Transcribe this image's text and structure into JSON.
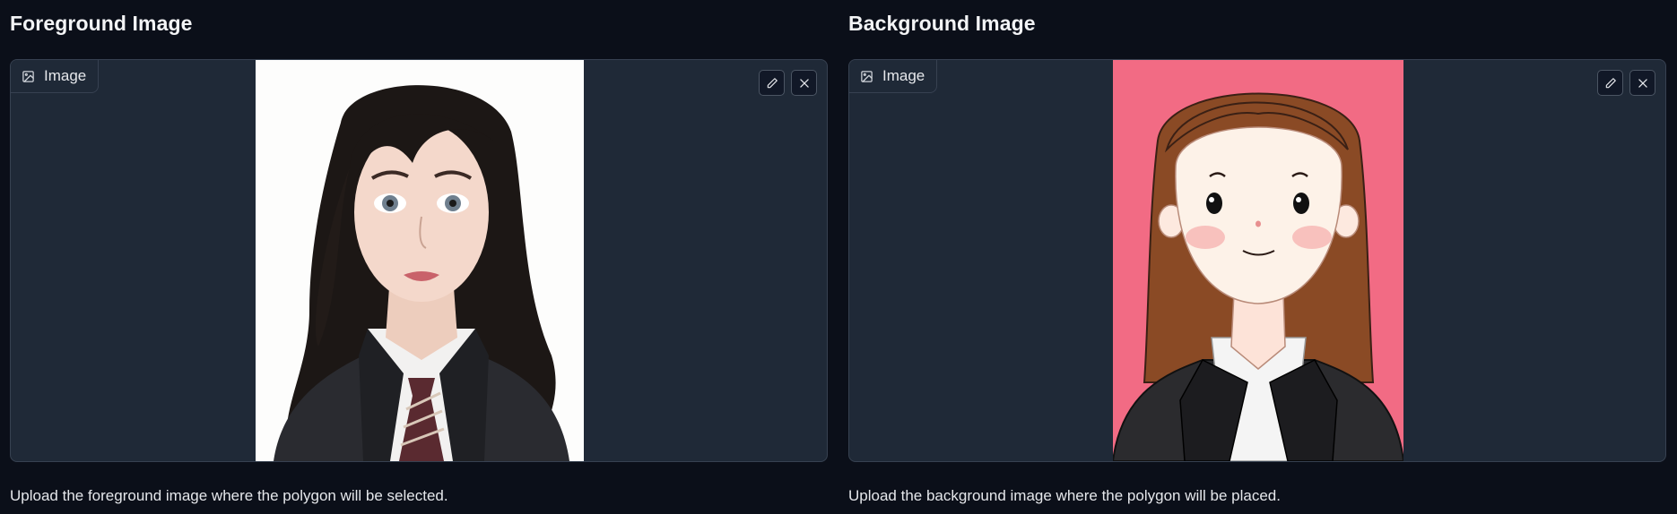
{
  "foreground": {
    "title": "Foreground Image",
    "label": "Image",
    "caption": "Upload the foreground image where the polygon will be selected."
  },
  "background": {
    "title": "Background Image",
    "label": "Image",
    "caption": "Upload the background image where the polygon will be placed."
  },
  "icons": {
    "label_icon": "image-icon",
    "edit": "pencil-icon",
    "clear": "close-icon"
  },
  "colors": {
    "page_bg": "#0b0f19",
    "panel_bg": "#1f2937",
    "border": "#374151",
    "foreground_photo_bg": "#fdfdfc",
    "background_photo_bg": "#f26b84"
  }
}
